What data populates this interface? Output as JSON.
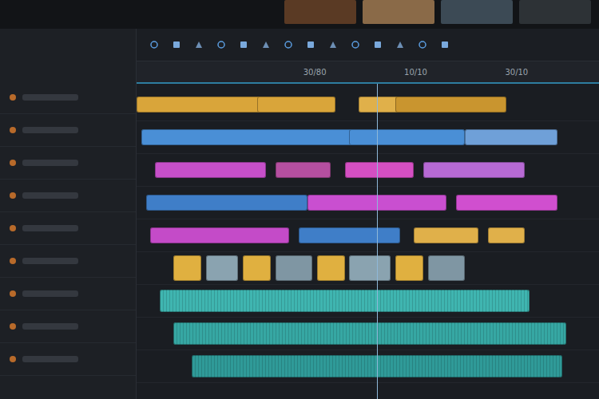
{
  "ruler": {
    "ticks": [
      "30/80",
      "10/10",
      "30/10"
    ]
  },
  "timeline": {
    "total": 100,
    "playhead": 52
  },
  "tracks": [
    {
      "kind": "video",
      "clips": [
        {
          "start": 0,
          "duration": 30,
          "color": "#d9a53a"
        },
        {
          "start": 26,
          "duration": 17,
          "color": "#d9a53a"
        },
        {
          "start": 48,
          "duration": 17,
          "color": "#e0b04a"
        },
        {
          "start": 56,
          "duration": 24,
          "color": "#c9952f"
        }
      ]
    },
    {
      "kind": "video",
      "clips": [
        {
          "start": 1,
          "duration": 47,
          "color": "#4a8fd6"
        },
        {
          "start": 46,
          "duration": 25,
          "color": "#4a8fd6"
        },
        {
          "start": 71,
          "duration": 20,
          "color": "#6fa0d8"
        }
      ]
    },
    {
      "kind": "video",
      "clips": [
        {
          "start": 4,
          "duration": 24,
          "color": "#c64fc9"
        },
        {
          "start": 30,
          "duration": 12,
          "color": "#b54fa0"
        },
        {
          "start": 45,
          "duration": 15,
          "color": "#d44fc2"
        },
        {
          "start": 62,
          "duration": 22,
          "color": "#b76ad4"
        }
      ]
    },
    {
      "kind": "video",
      "clips": [
        {
          "start": 2,
          "duration": 35,
          "color": "#3f7ec8"
        },
        {
          "start": 37,
          "duration": 30,
          "color": "#c94fd0"
        },
        {
          "start": 69,
          "duration": 22,
          "color": "#d04fcf"
        }
      ]
    },
    {
      "kind": "video",
      "clips": [
        {
          "start": 3,
          "duration": 30,
          "color": "#c44bc8"
        },
        {
          "start": 35,
          "duration": 22,
          "color": "#3f7ec8"
        },
        {
          "start": 60,
          "duration": 14,
          "color": "#e0b04a"
        },
        {
          "start": 76,
          "duration": 8,
          "color": "#e0b04a"
        }
      ]
    },
    {
      "kind": "broll",
      "clips": [
        {
          "start": 8,
          "duration": 6,
          "color": "#e0b040"
        },
        {
          "start": 15,
          "duration": 7,
          "color": "#8aa3b0"
        },
        {
          "start": 23,
          "duration": 6,
          "color": "#e0b040"
        },
        {
          "start": 30,
          "duration": 8,
          "color": "#7f96a3"
        },
        {
          "start": 39,
          "duration": 6,
          "color": "#e0b040"
        },
        {
          "start": 46,
          "duration": 9,
          "color": "#8aa3b0"
        },
        {
          "start": 56,
          "duration": 6,
          "color": "#e0b040"
        },
        {
          "start": 63,
          "duration": 8,
          "color": "#7f96a3"
        }
      ]
    },
    {
      "kind": "audio",
      "clips": [
        {
          "start": 5,
          "duration": 80,
          "color": "#3fb5b0"
        }
      ]
    },
    {
      "kind": "audio",
      "clips": [
        {
          "start": 8,
          "duration": 85,
          "color": "#36a7a3"
        }
      ]
    },
    {
      "kind": "audio",
      "clips": [
        {
          "start": 12,
          "duration": 80,
          "color": "#2f9a98"
        }
      ]
    }
  ]
}
